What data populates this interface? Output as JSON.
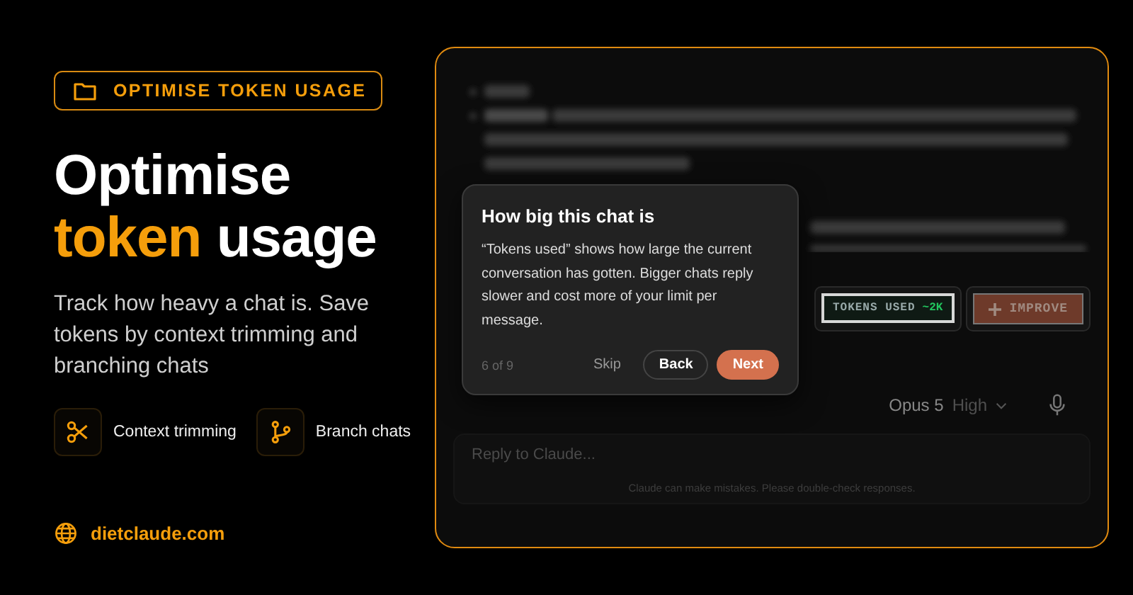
{
  "badge": {
    "label": "OPTIMISE TOKEN USAGE"
  },
  "headline": {
    "line1": "Optimise",
    "highlight": "token",
    "rest": "usage"
  },
  "description": "Track how heavy a chat is. Save tokens by context trimming and branching chats",
  "features": [
    {
      "kind": "scissors",
      "label": "Context trimming"
    },
    {
      "kind": "branch",
      "label": "Branch chats"
    }
  ],
  "website": "dietclaude.com",
  "tour": {
    "title": "How big this chat is",
    "body": "“Tokens used” shows how large the current conversation has gotten. Bigger chats reply slower and cost more of your limit per message.",
    "step": "6 of 9",
    "buttons": [
      {
        "kind": "skip",
        "label": "Skip"
      },
      {
        "kind": "back",
        "label": "Back"
      },
      {
        "kind": "next",
        "label": "Next"
      }
    ]
  },
  "token_widget": {
    "label": "TOKENS USED",
    "value": "~2K"
  },
  "improve_button": {
    "label": "IMPROVE"
  },
  "composer": {
    "model": "Opus 5",
    "effort": "High",
    "placeholder": "Reply to Claude...",
    "disclaimer": "Claude can make mistakes. Please double-check responses."
  }
}
